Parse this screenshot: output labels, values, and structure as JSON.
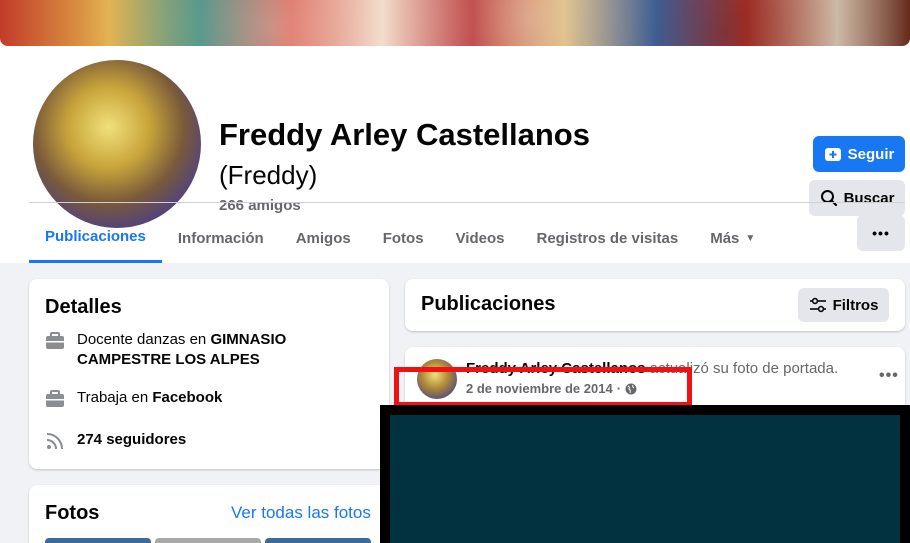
{
  "profile": {
    "name": "Freddy Arley Castellanos",
    "nickname": "(Freddy)",
    "friends": "266 amigos"
  },
  "actions": {
    "follow_label": "Seguir",
    "search_label": "Buscar"
  },
  "tabs": [
    {
      "label": "Publicaciones",
      "active": true
    },
    {
      "label": "Información"
    },
    {
      "label": "Amigos"
    },
    {
      "label": "Fotos"
    },
    {
      "label": "Videos"
    },
    {
      "label": "Registros de visitas"
    },
    {
      "label": "Más"
    }
  ],
  "details": {
    "title": "Detalles",
    "work1_pre": "Docente danzas en ",
    "work1_place": "GIMNASIO CAMPESTRE LOS ALPES",
    "work2_pre": "Trabaja en ",
    "work2_place": "Facebook",
    "followers": "274 seguidores"
  },
  "photos": {
    "title": "Fotos",
    "see_all": "Ver todas las fotos"
  },
  "posts": {
    "title": "Publicaciones",
    "filter_label": "Filtros"
  },
  "post": {
    "author": "Freddy Arley Castellanos",
    "action": " actualizó su foto de portada.",
    "date": "2 de noviembre de 2014",
    "sep": "·"
  },
  "colors": {
    "accent": "#1877f2",
    "highlight": "#f01212",
    "overlay": "#02313f"
  },
  "icons": [
    "plus-user-icon",
    "search-icon",
    "briefcase-icon",
    "rss-icon",
    "filter-icon",
    "globe-icon",
    "more-icon",
    "caret-down-icon"
  ]
}
